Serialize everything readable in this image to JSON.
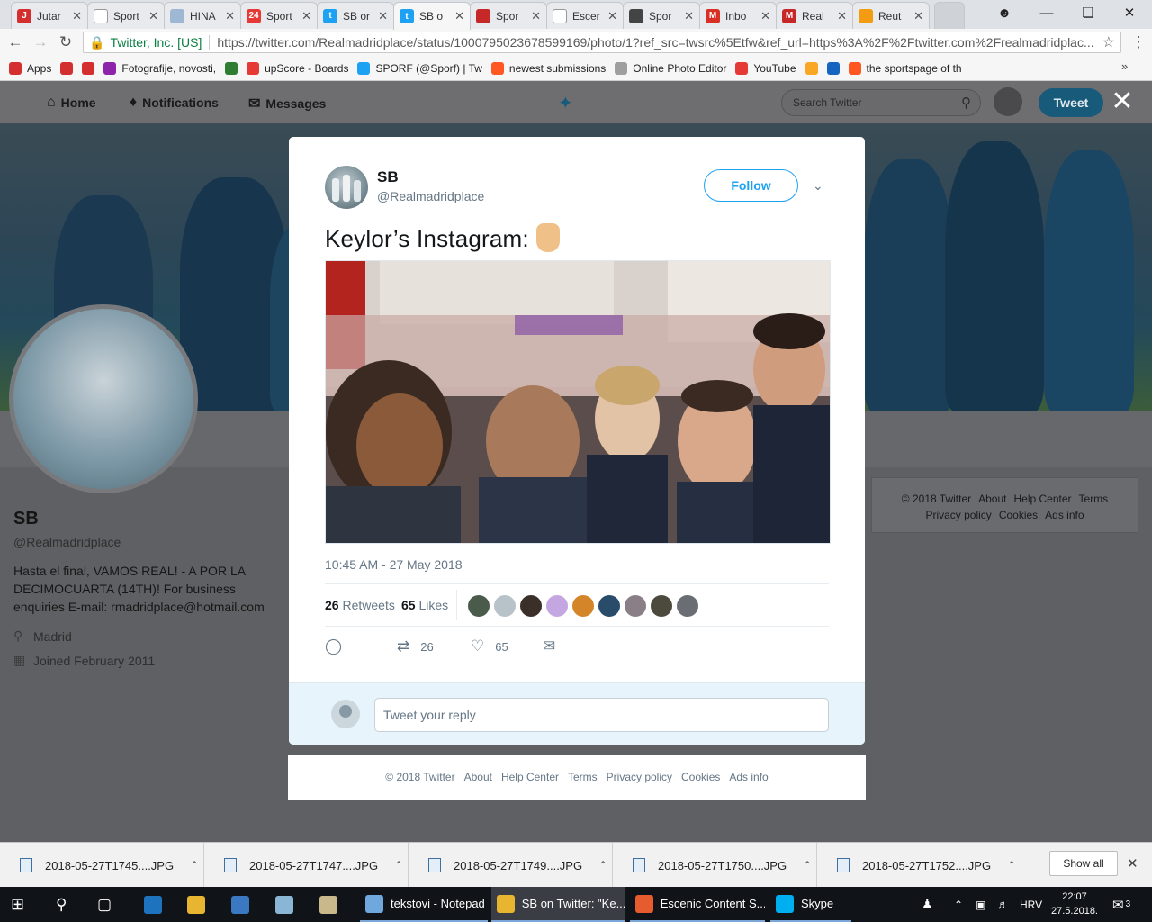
{
  "browser": {
    "tabs": [
      {
        "label": "Jutar",
        "fav": "J",
        "color": "#d32f2f"
      },
      {
        "label": "Sport",
        "fav": "",
        "color": "#ffffff"
      },
      {
        "label": "HINA",
        "fav": "",
        "color": "#9eb7d3"
      },
      {
        "label": "Sport",
        "fav": "24",
        "color": "#e53935"
      },
      {
        "label": "SB or",
        "fav": "t",
        "color": "#1da1f2"
      },
      {
        "label": "SB o",
        "fav": "t",
        "color": "#1da1f2"
      },
      {
        "label": "Spor",
        "fav": "",
        "color": "#c62828"
      },
      {
        "label": "Escer",
        "fav": "",
        "color": "#ffffff"
      },
      {
        "label": "Spor",
        "fav": "",
        "color": "#444444"
      },
      {
        "label": "Inbo",
        "fav": "M",
        "color": "#d93025"
      },
      {
        "label": "Real",
        "fav": "M",
        "color": "#c62828"
      },
      {
        "label": "Reut",
        "fav": "",
        "color": "#f39c12"
      }
    ],
    "omnibox": {
      "secure_label": "Twitter, Inc. [US]",
      "url": "https://twitter.com/Realmadridplace/status/1000795023678599169/photo/1?ref_src=twsrc%5Etfw&ref_url=https%3A%2F%2Ftwitter.com%2Frealmadridplac..."
    },
    "bookmarks": [
      {
        "label": "Apps",
        "color": "#d32f2f"
      },
      {
        "label": "",
        "color": "#d32f2f"
      },
      {
        "label": "",
        "color": "#d32f2f"
      },
      {
        "label": "Fotografije, novosti,",
        "color": "#8e24aa"
      },
      {
        "label": "",
        "color": "#2e7d32"
      },
      {
        "label": "upScore - Boards",
        "color": "#e53935"
      },
      {
        "label": "SPORF (@Sporf) | Tw",
        "color": "#1da1f2"
      },
      {
        "label": "newest submissions",
        "color": "#ff5722"
      },
      {
        "label": "Online Photo Editor",
        "color": "#9e9e9e"
      },
      {
        "label": "YouTube",
        "color": "#e53935"
      },
      {
        "label": "",
        "color": "#f9a825"
      },
      {
        "label": "",
        "color": "#1565c0"
      },
      {
        "label": "the sportspage of th",
        "color": "#ff5722"
      }
    ]
  },
  "twitter_nav": {
    "home": "Home",
    "notifications": "Notifications",
    "messages": "Messages",
    "search_placeholder": "Search Twitter",
    "tweet_button": "Tweet"
  },
  "profile": {
    "name": "SB",
    "handle": "@Realmadridplace",
    "bio": "Hasta el final, VAMOS REAL! - A POR LA DECIMOCUARTA (14TH)! For business enquiries E-mail: rmadridplace@hotmail.com",
    "location": "Madrid",
    "joined": "Joined February 2011"
  },
  "side_footer": {
    "links": [
      "© 2018 Twitter",
      "About",
      "Help Center",
      "Terms",
      "Privacy policy",
      "Cookies",
      "Ads info"
    ]
  },
  "tweet": {
    "name": "SB",
    "handle": "@Realmadridplace",
    "follow_label": "Follow",
    "text": "Keylor’s Instagram:",
    "timestamp": "10:45 AM - 27 May 2018",
    "retweets_count": "26",
    "retweets_label": "Retweets",
    "likes_count": "65",
    "likes_label": "Likes",
    "action_retweets": "26",
    "action_likes": "65",
    "reply_placeholder": "Tweet your reply",
    "liker_colors": [
      "#4a5b4c",
      "#b8c2c9",
      "#3b2f2a",
      "#c4a6e0",
      "#d4852a",
      "#2a4c6b",
      "#8a7f86",
      "#4c4a3c",
      "#6a6e74"
    ]
  },
  "modal_footer": {
    "links": [
      "© 2018 Twitter",
      "About",
      "Help Center",
      "Terms",
      "Privacy policy",
      "Cookies",
      "Ads info"
    ]
  },
  "downloads": {
    "files": [
      "2018-05-27T1745....JPG",
      "2018-05-27T1747....JPG",
      "2018-05-27T1749....JPG",
      "2018-05-27T1750....JPG",
      "2018-05-27T1752....JPG"
    ],
    "show_all": "Show all"
  },
  "taskbar": {
    "apps": [
      {
        "label": "tekstovi - Notepad",
        "color": "#6fa8dc"
      },
      {
        "label": "SB on Twitter: \"Ke...",
        "color": "#e8b530"
      },
      {
        "label": "Escenic Content S...",
        "color": "#e65c2e"
      },
      {
        "label": "Skype",
        "color": "#00aff0"
      }
    ],
    "language": "HRV",
    "time": "22:07",
    "date": "27.5.2018.",
    "notifications": "3"
  }
}
